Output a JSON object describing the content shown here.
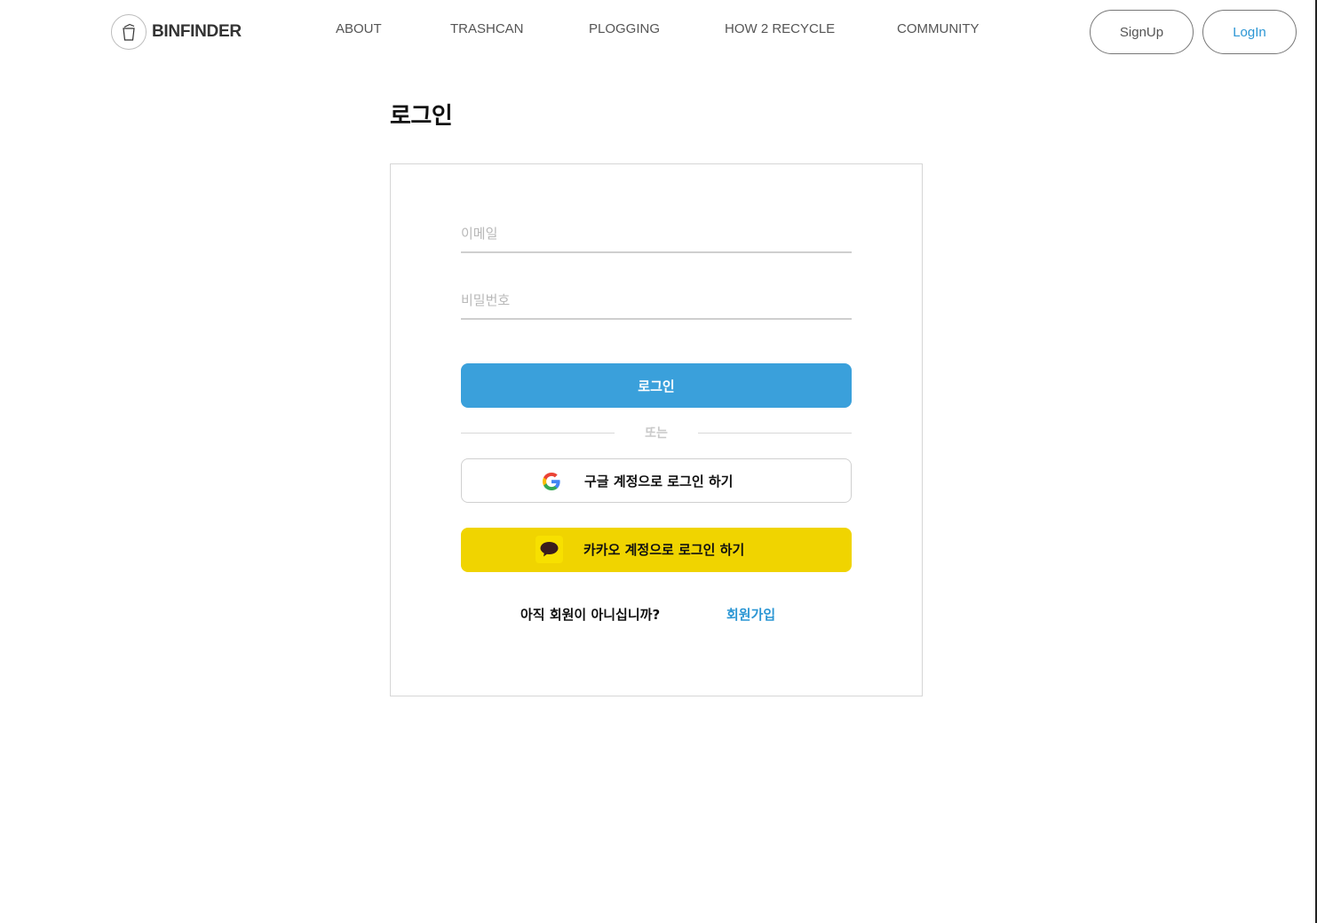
{
  "header": {
    "brand": "BINFINDER",
    "nav": {
      "about": "ABOUT",
      "trashcan": "TRASHCAN",
      "plogging": "PLOGGING",
      "how2recycle": "HOW 2 RECYCLE",
      "community": "COMMUNITY"
    },
    "signup_label": "SignUp",
    "login_label": "LogIn"
  },
  "main": {
    "title": "로그인",
    "email_placeholder": "이메일",
    "password_placeholder": "비밀번호",
    "login_button": "로그인",
    "divider_text": "또는",
    "google_button": "구글 계정으로 로그인 하기",
    "kakao_button": "카카오 계정으로 로그인 하기",
    "signup_prompt": "아직 회원이 아니십니까?",
    "signup_link": "회원가입"
  },
  "colors": {
    "accent": "#3aa0db",
    "link": "#2b96d4",
    "kakao": "#f0d400"
  },
  "icons": {
    "logo": "trashcan-logo-icon",
    "google": "google-icon",
    "kakao": "kakao-talk-icon"
  }
}
